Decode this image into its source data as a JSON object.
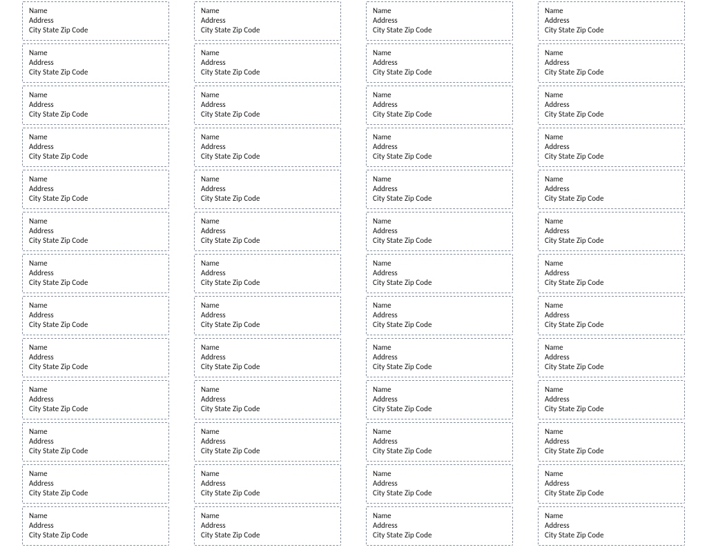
{
  "template_label": {
    "line1": "Name",
    "line2": "Address",
    "line3": "City State  Zip Code"
  },
  "layout": {
    "columns": 4,
    "rows": 13
  }
}
